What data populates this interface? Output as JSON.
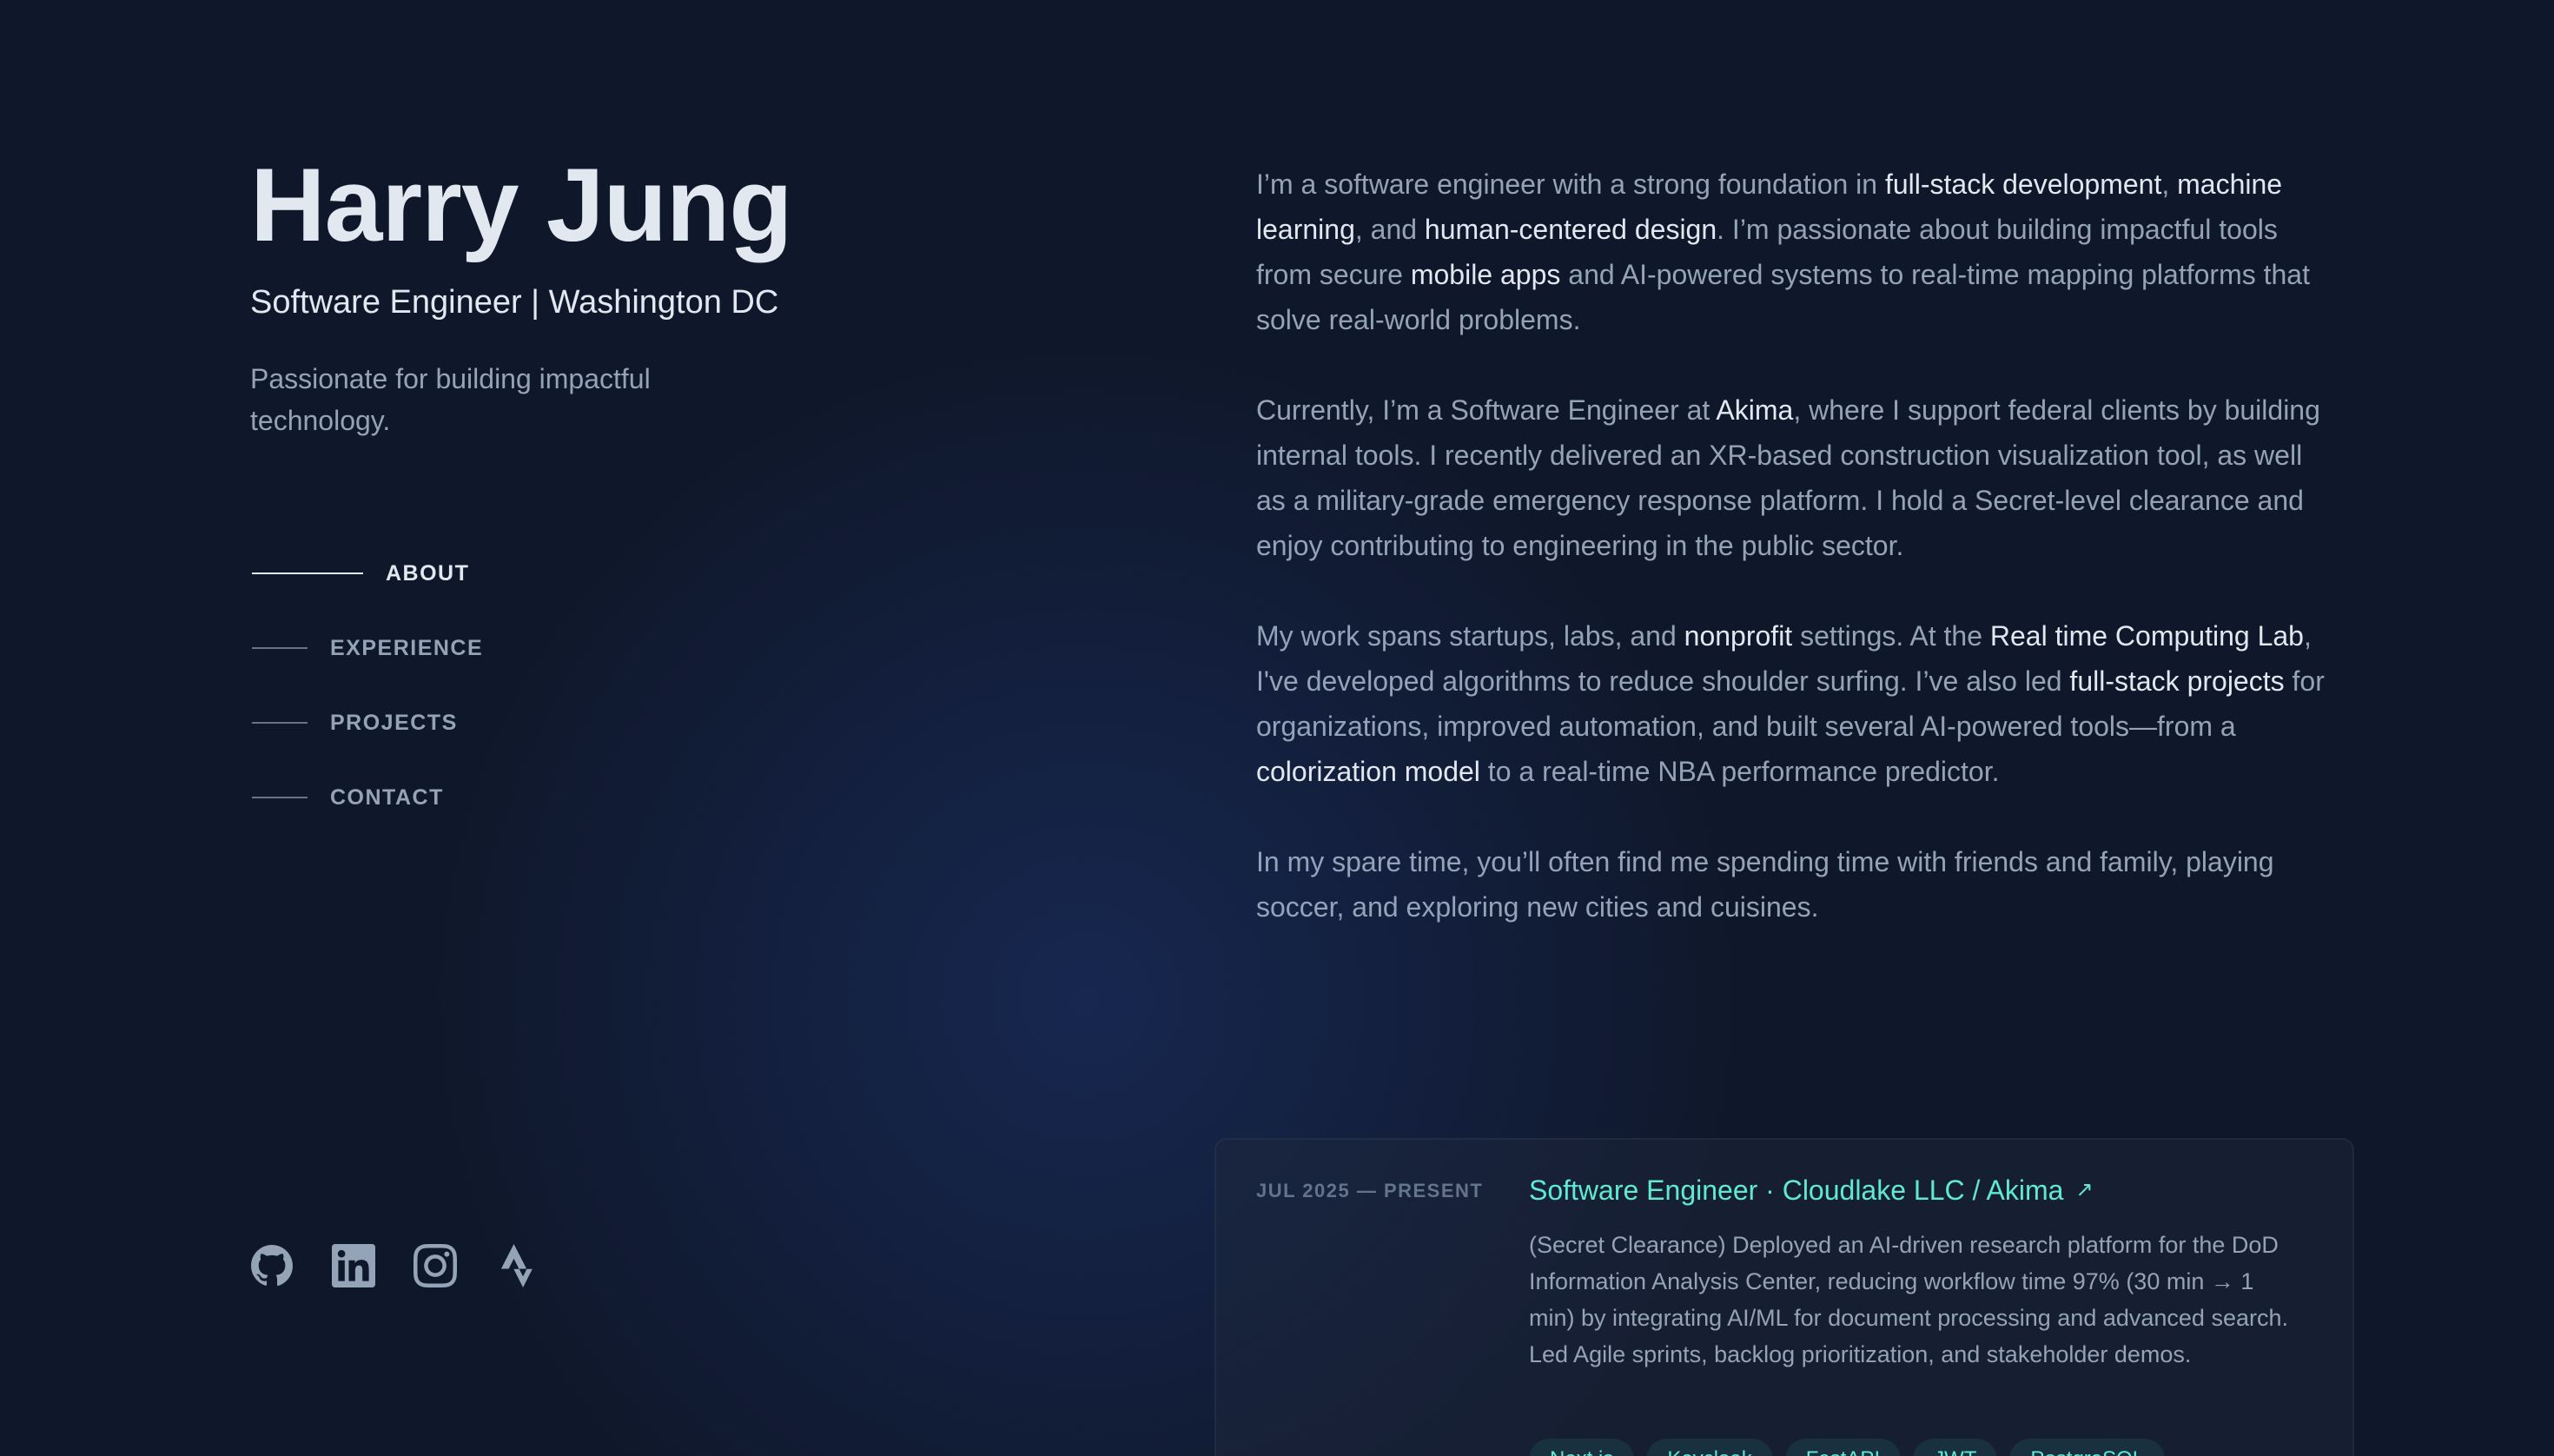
{
  "header": {
    "name": "Harry Jung",
    "role": "Software Engineer | Washington DC",
    "tagline": "Passionate for building impactful technology."
  },
  "nav": [
    {
      "label": "ABOUT",
      "active": true
    },
    {
      "label": "EXPERIENCE",
      "active": false
    },
    {
      "label": "PROJECTS",
      "active": false
    },
    {
      "label": "CONTACT",
      "active": false
    }
  ],
  "socials": [
    "github-icon",
    "linkedin-icon",
    "instagram-icon",
    "strava-icon"
  ],
  "about": {
    "p1": [
      {
        "t": "I’m a software engineer with a strong foundation in "
      },
      {
        "t": "full-stack development",
        "h": true
      },
      {
        "t": ", "
      },
      {
        "t": "machine learning",
        "h": true
      },
      {
        "t": ", and "
      },
      {
        "t": "human-centered design",
        "h": true
      },
      {
        "t": ". I’m passionate about building impactful tools from secure "
      },
      {
        "t": "mobile apps",
        "h": true
      },
      {
        "t": " and AI-powered systems to real-time mapping platforms that solve real-world problems."
      }
    ],
    "p2": [
      {
        "t": "Currently, I’m a Software Engineer at "
      },
      {
        "t": "Akima",
        "h": true
      },
      {
        "t": ", where I support federal clients by building internal tools. I recently delivered an XR-based construction visualization tool, as well as a military-grade emergency response platform. I hold a Secret-level clearance and enjoy contributing to engineering in the public sector."
      }
    ],
    "p3": [
      {
        "t": "My work spans startups, labs, and "
      },
      {
        "t": "nonprofit",
        "h": true
      },
      {
        "t": " settings. At the "
      },
      {
        "t": "Real time Computing Lab",
        "h": true
      },
      {
        "t": ", I've developed algorithms to reduce shoulder surfing. I’ve also led "
      },
      {
        "t": "full-stack projects",
        "h": true
      },
      {
        "t": " for organizations, improved automation, and built several AI-powered tools—from a "
      },
      {
        "t": "colorization model",
        "h": true
      },
      {
        "t": " to a real-time NBA performance predictor."
      }
    ],
    "p4": [
      {
        "t": "In my spare time, you’ll often find me spending time with friends and family, playing soccer, and exploring new cities and cuisines."
      }
    ]
  },
  "experience": {
    "date": "JUL 2025 — PRESENT",
    "title": "Software Engineer · Cloudlake LLC / Akima",
    "arrow": "↗",
    "description": "(Secret Clearance) Deployed an AI-driven research platform for the DoD Information Analysis Center, reducing workflow time 97% (30 min → 1 min) by integrating AI/ML for document processing and advanced search. Led Agile sprints, backlog prioritization, and stakeholder demos.",
    "tags": [
      "Next.js",
      "Keycloak",
      "FastAPI",
      "JWT",
      "PostgreSQL"
    ]
  },
  "colors": {
    "background": "#0f172a",
    "text": "#94a3b8",
    "highlight": "#e2e8f0",
    "accent": "#5eead4"
  }
}
